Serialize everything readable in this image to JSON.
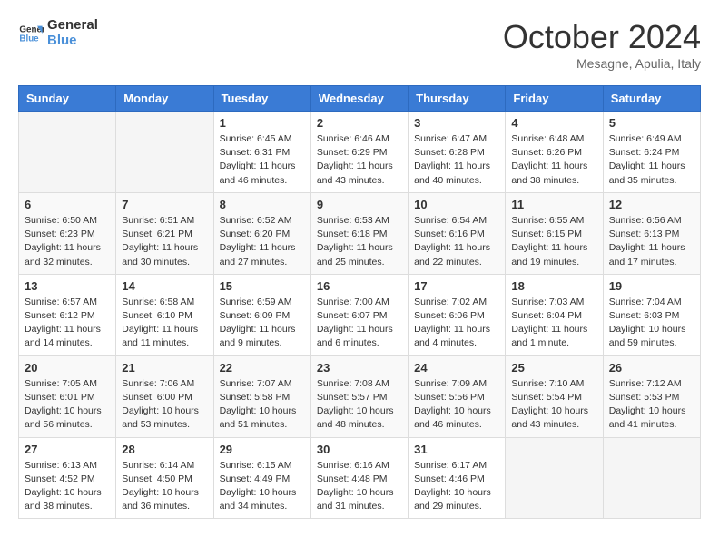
{
  "header": {
    "logo": {
      "line1": "General",
      "line2": "Blue"
    },
    "title": "October 2024",
    "location": "Mesagne, Apulia, Italy"
  },
  "weekdays": [
    "Sunday",
    "Monday",
    "Tuesday",
    "Wednesday",
    "Thursday",
    "Friday",
    "Saturday"
  ],
  "weeks": [
    [
      {
        "day": null,
        "info": null
      },
      {
        "day": null,
        "info": null
      },
      {
        "day": "1",
        "info": "Sunrise: 6:45 AM\nSunset: 6:31 PM\nDaylight: 11 hours and 46 minutes."
      },
      {
        "day": "2",
        "info": "Sunrise: 6:46 AM\nSunset: 6:29 PM\nDaylight: 11 hours and 43 minutes."
      },
      {
        "day": "3",
        "info": "Sunrise: 6:47 AM\nSunset: 6:28 PM\nDaylight: 11 hours and 40 minutes."
      },
      {
        "day": "4",
        "info": "Sunrise: 6:48 AM\nSunset: 6:26 PM\nDaylight: 11 hours and 38 minutes."
      },
      {
        "day": "5",
        "info": "Sunrise: 6:49 AM\nSunset: 6:24 PM\nDaylight: 11 hours and 35 minutes."
      }
    ],
    [
      {
        "day": "6",
        "info": "Sunrise: 6:50 AM\nSunset: 6:23 PM\nDaylight: 11 hours and 32 minutes."
      },
      {
        "day": "7",
        "info": "Sunrise: 6:51 AM\nSunset: 6:21 PM\nDaylight: 11 hours and 30 minutes."
      },
      {
        "day": "8",
        "info": "Sunrise: 6:52 AM\nSunset: 6:20 PM\nDaylight: 11 hours and 27 minutes."
      },
      {
        "day": "9",
        "info": "Sunrise: 6:53 AM\nSunset: 6:18 PM\nDaylight: 11 hours and 25 minutes."
      },
      {
        "day": "10",
        "info": "Sunrise: 6:54 AM\nSunset: 6:16 PM\nDaylight: 11 hours and 22 minutes."
      },
      {
        "day": "11",
        "info": "Sunrise: 6:55 AM\nSunset: 6:15 PM\nDaylight: 11 hours and 19 minutes."
      },
      {
        "day": "12",
        "info": "Sunrise: 6:56 AM\nSunset: 6:13 PM\nDaylight: 11 hours and 17 minutes."
      }
    ],
    [
      {
        "day": "13",
        "info": "Sunrise: 6:57 AM\nSunset: 6:12 PM\nDaylight: 11 hours and 14 minutes."
      },
      {
        "day": "14",
        "info": "Sunrise: 6:58 AM\nSunset: 6:10 PM\nDaylight: 11 hours and 11 minutes."
      },
      {
        "day": "15",
        "info": "Sunrise: 6:59 AM\nSunset: 6:09 PM\nDaylight: 11 hours and 9 minutes."
      },
      {
        "day": "16",
        "info": "Sunrise: 7:00 AM\nSunset: 6:07 PM\nDaylight: 11 hours and 6 minutes."
      },
      {
        "day": "17",
        "info": "Sunrise: 7:02 AM\nSunset: 6:06 PM\nDaylight: 11 hours and 4 minutes."
      },
      {
        "day": "18",
        "info": "Sunrise: 7:03 AM\nSunset: 6:04 PM\nDaylight: 11 hours and 1 minute."
      },
      {
        "day": "19",
        "info": "Sunrise: 7:04 AM\nSunset: 6:03 PM\nDaylight: 10 hours and 59 minutes."
      }
    ],
    [
      {
        "day": "20",
        "info": "Sunrise: 7:05 AM\nSunset: 6:01 PM\nDaylight: 10 hours and 56 minutes."
      },
      {
        "day": "21",
        "info": "Sunrise: 7:06 AM\nSunset: 6:00 PM\nDaylight: 10 hours and 53 minutes."
      },
      {
        "day": "22",
        "info": "Sunrise: 7:07 AM\nSunset: 5:58 PM\nDaylight: 10 hours and 51 minutes."
      },
      {
        "day": "23",
        "info": "Sunrise: 7:08 AM\nSunset: 5:57 PM\nDaylight: 10 hours and 48 minutes."
      },
      {
        "day": "24",
        "info": "Sunrise: 7:09 AM\nSunset: 5:56 PM\nDaylight: 10 hours and 46 minutes."
      },
      {
        "day": "25",
        "info": "Sunrise: 7:10 AM\nSunset: 5:54 PM\nDaylight: 10 hours and 43 minutes."
      },
      {
        "day": "26",
        "info": "Sunrise: 7:12 AM\nSunset: 5:53 PM\nDaylight: 10 hours and 41 minutes."
      }
    ],
    [
      {
        "day": "27",
        "info": "Sunrise: 6:13 AM\nSunset: 4:52 PM\nDaylight: 10 hours and 38 minutes."
      },
      {
        "day": "28",
        "info": "Sunrise: 6:14 AM\nSunset: 4:50 PM\nDaylight: 10 hours and 36 minutes."
      },
      {
        "day": "29",
        "info": "Sunrise: 6:15 AM\nSunset: 4:49 PM\nDaylight: 10 hours and 34 minutes."
      },
      {
        "day": "30",
        "info": "Sunrise: 6:16 AM\nSunset: 4:48 PM\nDaylight: 10 hours and 31 minutes."
      },
      {
        "day": "31",
        "info": "Sunrise: 6:17 AM\nSunset: 4:46 PM\nDaylight: 10 hours and 29 minutes."
      },
      {
        "day": null,
        "info": null
      },
      {
        "day": null,
        "info": null
      }
    ]
  ]
}
